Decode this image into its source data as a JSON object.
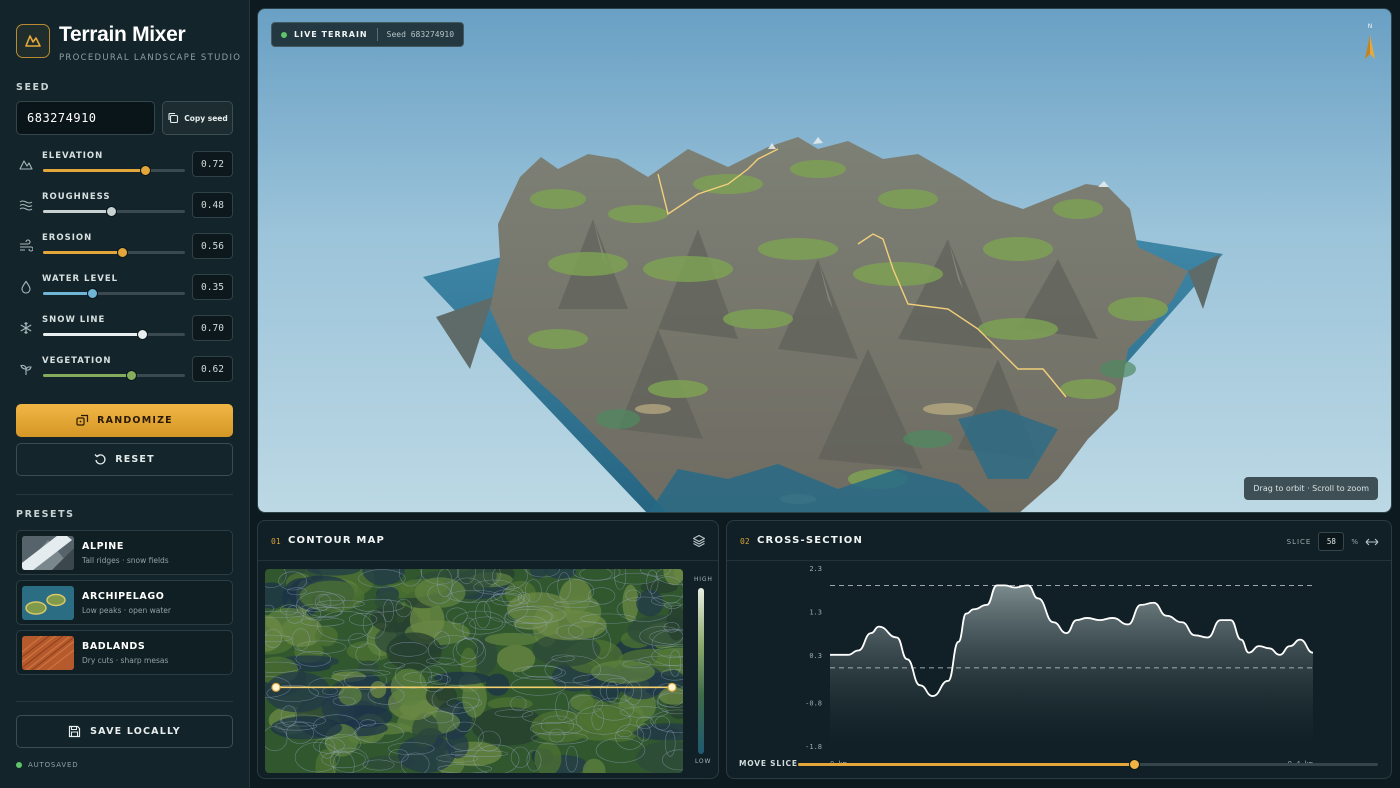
{
  "app": {
    "title": "Terrain Mixer",
    "subtitle": "PROCEDURAL LANDSCAPE STUDIO",
    "accent": "#e6a93a"
  },
  "seed": {
    "label": "SEED",
    "value": "683274910",
    "copy_label": "Copy seed"
  },
  "params": [
    {
      "label": "ELEVATION",
      "value": "0.72",
      "icon": "mountain-icon",
      "color": "#e2a63a"
    },
    {
      "label": "ROUGHNESS",
      "value": "0.48",
      "icon": "waves-icon",
      "color": "#c9d2d3"
    },
    {
      "label": "EROSION",
      "value": "0.56",
      "icon": "wind-icon",
      "color": "#e2a63a"
    },
    {
      "label": "WATER LEVEL",
      "value": "0.35",
      "icon": "droplet-icon",
      "color": "#6fb6d6"
    },
    {
      "label": "SNOW LINE",
      "value": "0.70",
      "icon": "snowflake-icon",
      "color": "#e9eef0"
    },
    {
      "label": "VEGETATION",
      "value": "0.62",
      "icon": "sprout-icon",
      "color": "#84ac5c"
    }
  ],
  "actions": {
    "randomize": "RANDOMIZE",
    "reset": "RESET",
    "save": "SAVE LOCALLY"
  },
  "presets": {
    "label": "PRESETS",
    "items": [
      {
        "name": "ALPINE",
        "desc": "Tall ridges · snow fields"
      },
      {
        "name": "ARCHIPELAGO",
        "desc": "Low peaks · open water"
      },
      {
        "name": "BADLANDS",
        "desc": "Dry cuts · sharp mesas"
      }
    ]
  },
  "status": {
    "autosave": "AUTOSAVED"
  },
  "viewport": {
    "live_label": "LIVE TERRAIN",
    "seed_label": "Seed 683274910",
    "hint": "Drag to orbit · Scroll to zoom",
    "compass": "N"
  },
  "contour": {
    "num": "01",
    "title": "CONTOUR MAP",
    "legend_high": "HIGH",
    "legend_low": "LOW",
    "slice_row": 0.58
  },
  "cross_section": {
    "num": "02",
    "title": "CROSS-SECTION",
    "slice_label": "SLICE",
    "slice_value": "58",
    "slice_unit": "%",
    "move_label": "MOVE SLICE",
    "move_value": 0.58
  },
  "chart_data": {
    "type": "area",
    "ytick_labels": [
      "2.3",
      "1.3",
      "0.3",
      "-0.8",
      "-1.8"
    ],
    "ylim": [
      -1.8,
      2.3
    ],
    "x_start_label": "0 km",
    "x_end_label": "9.4 km",
    "xlim": [
      0,
      9.4
    ],
    "snow_line": 1.9,
    "water_line": 0.0,
    "x": [
      0,
      0.35,
      0.55,
      0.8,
      0.95,
      1.3,
      1.5,
      1.75,
      2.0,
      2.3,
      2.5,
      2.65,
      2.8,
      3.05,
      3.25,
      3.4,
      3.6,
      3.85,
      4.05,
      4.35,
      4.6,
      4.8,
      5.0,
      5.25,
      5.5,
      5.8,
      6.05,
      6.3,
      6.55,
      6.85,
      7.1,
      7.35,
      7.6,
      7.8,
      8.0,
      8.15,
      8.35,
      8.55,
      8.75,
      8.95,
      9.15,
      9.4
    ],
    "y": [
      0.3,
      0.3,
      0.4,
      0.8,
      0.95,
      0.7,
      0.2,
      -0.4,
      -0.65,
      -0.3,
      0.6,
      1.25,
      1.35,
      1.45,
      1.9,
      1.9,
      1.85,
      1.9,
      1.6,
      1.05,
      0.8,
      1.1,
      1.15,
      1.1,
      1.15,
      1.0,
      1.45,
      1.5,
      1.2,
      1.05,
      0.75,
      0.7,
      1.1,
      1.1,
      0.65,
      0.35,
      0.5,
      0.45,
      0.3,
      0.5,
      0.65,
      0.35
    ]
  }
}
